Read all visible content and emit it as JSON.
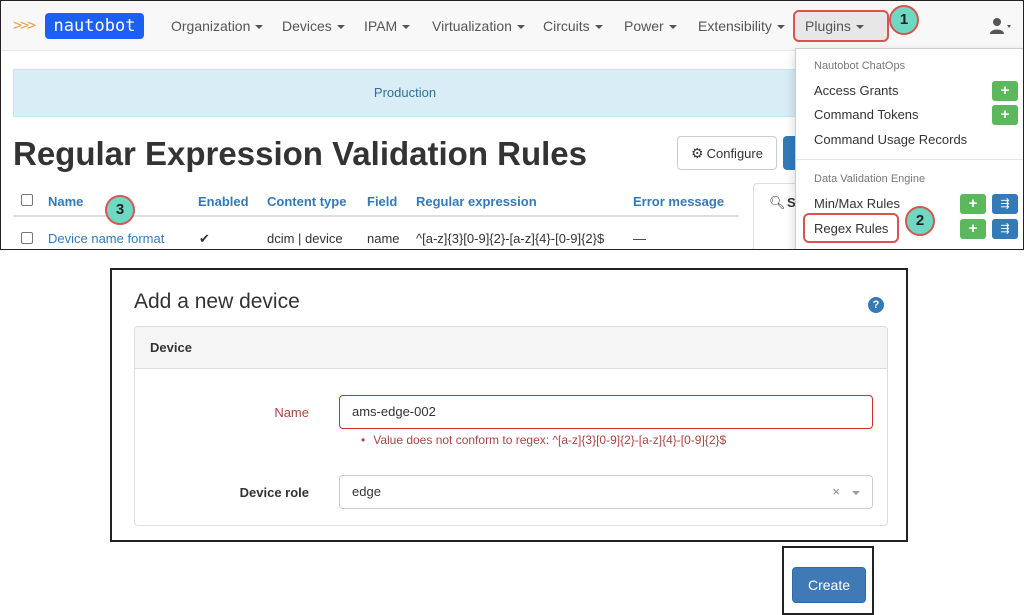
{
  "brand": {
    "arrows": ">>>",
    "name": "nautobot"
  },
  "nav": {
    "items": [
      {
        "label": "Organization"
      },
      {
        "label": "Devices"
      },
      {
        "label": "IPAM"
      },
      {
        "label": "Virtualization"
      },
      {
        "label": "Circuits"
      },
      {
        "label": "Power"
      },
      {
        "label": "Extensibility"
      },
      {
        "label": "Plugins"
      }
    ]
  },
  "annotations": [
    "1",
    "2",
    "3"
  ],
  "banner": "Production",
  "page_title": "Regular Expression Validation Rules",
  "configure_label": "Configure",
  "table": {
    "headers": [
      "Name",
      "Enabled",
      "Content type",
      "Field",
      "Regular expression",
      "Error message"
    ],
    "rows": [
      {
        "name": "Device name format",
        "enabled": "✔",
        "content_type": "dcim | device",
        "field": "name",
        "regex": "^[a-z]{3}[0-9]{2}-[a-z]{4}-[0-9]{2}$",
        "error": "—"
      }
    ]
  },
  "search_label": "S",
  "plugins_menu": {
    "sections": [
      {
        "header": "Nautobot ChatOps",
        "items": [
          {
            "label": "Access Grants",
            "buttons": [
              "add"
            ]
          },
          {
            "label": "Command Tokens",
            "buttons": [
              "add"
            ]
          },
          {
            "label": "Command Usage Records",
            "buttons": []
          }
        ]
      },
      {
        "header": "Data Validation Engine",
        "items": [
          {
            "label": "Min/Max Rules",
            "buttons": [
              "add",
              "import"
            ]
          },
          {
            "label": "Regex Rules",
            "buttons": [
              "add",
              "import"
            ]
          }
        ]
      }
    ]
  },
  "form": {
    "title": "Add a new device",
    "help": "?",
    "section": "Device",
    "name_label": "Name",
    "name_value": "ams-edge-002",
    "name_error": "Value does not conform to regex: ^[a-z]{3}[0-9]{2}-[a-z]{4}-[0-9]{2}$",
    "role_label": "Device role",
    "role_value": "edge",
    "clear_glyph": "×",
    "create_label": "Create"
  },
  "colors": {
    "brand": "#1c5ff5",
    "link": "#337ab7",
    "danger": "#d9534f",
    "error_text": "#a94442",
    "success": "#5cb85c",
    "annotation": "#6fd8c3",
    "banner_bg": "#d9edf7"
  }
}
